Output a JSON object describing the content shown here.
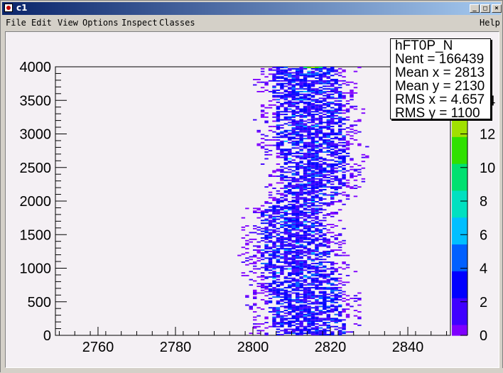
{
  "window": {
    "title": "c1"
  },
  "menu": {
    "file": "File",
    "edit": "Edit",
    "view": "View",
    "options": "Options",
    "inspect": "Inspect",
    "classes": "Classes",
    "help": "Help"
  },
  "stats": {
    "name": "hFT0P_N",
    "nent": "Nent = 166439",
    "mean_x": "Mean x =   2813",
    "mean_y": "Mean y =   2130",
    "rms_x": "RMS x =  4.657",
    "rms_y": "RMS y =   1100"
  },
  "chart_data": {
    "type": "heatmap",
    "title": "",
    "xlabel": "",
    "ylabel": "",
    "xlim": [
      2749,
      2851
    ],
    "ylim": [
      0,
      4000
    ],
    "x_ticks": [
      2760,
      2780,
      2800,
      2820,
      2840
    ],
    "y_ticks": [
      0,
      500,
      1000,
      1500,
      2000,
      2500,
      3000,
      3500,
      4000
    ],
    "z_ticks": [
      0,
      2,
      4,
      6,
      8,
      10,
      12,
      14
    ],
    "zlim": [
      0,
      16
    ],
    "colormap": [
      "#7f00ff",
      "#3f00ff",
      "#0000ff",
      "#0060ff",
      "#00bfff",
      "#00e0c0",
      "#00e070",
      "#30e000",
      "#a0e000",
      "#e0e000",
      "#ffff00"
    ],
    "band": [
      {
        "y": 4000,
        "x_lo": 2805,
        "x_hi": 2822
      },
      {
        "y": 3000,
        "x_lo": 2806,
        "x_hi": 2824
      },
      {
        "y": 2500,
        "x_lo": 2807,
        "x_hi": 2825
      },
      {
        "y": 2100,
        "x_lo": 2808,
        "x_hi": 2823
      },
      {
        "y": 1800,
        "x_lo": 2802,
        "x_hi": 2818
      },
      {
        "y": 1200,
        "x_lo": 2802,
        "x_hi": 2820
      },
      {
        "y": 600,
        "x_lo": 2804,
        "x_hi": 2823
      },
      {
        "y": 0,
        "x_lo": 2805,
        "x_hi": 2824
      }
    ],
    "hotspots": [
      {
        "x": 2815,
        "y": 3980,
        "z": 13
      },
      {
        "x": 2814,
        "y": 3880,
        "z": 7
      },
      {
        "x": 2813,
        "y": 3620,
        "z": 7
      },
      {
        "x": 2812,
        "y": 3500,
        "z": 6
      }
    ]
  }
}
